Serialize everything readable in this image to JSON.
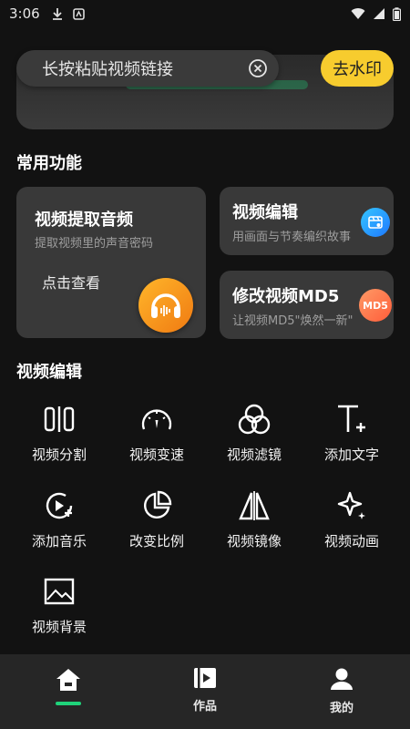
{
  "status_bar": {
    "time": "3:06"
  },
  "search": {
    "placeholder": "长按粘贴视频链接",
    "action_label": "去水印"
  },
  "sections": {
    "common_title": "常用功能",
    "tools_title": "视频编辑"
  },
  "cards": {
    "extract_audio": {
      "title": "视频提取音频",
      "subtitle": "提取视频里的声音密码",
      "action": "点击查看"
    },
    "video_edit": {
      "title": "视频编辑",
      "subtitle": "用画面与节奏编织故事"
    },
    "modify_md5": {
      "title": "修改视频MD5",
      "subtitle": "让视频MD5\"焕然一新\"",
      "badge": "MD5"
    }
  },
  "tools": [
    {
      "label": "视频分割",
      "icon": "split-icon"
    },
    {
      "label": "视频变速",
      "icon": "speedometer-icon"
    },
    {
      "label": "视频滤镜",
      "icon": "filter-icon"
    },
    {
      "label": "添加文字",
      "icon": "add-text-icon"
    },
    {
      "label": "添加音乐",
      "icon": "add-music-icon"
    },
    {
      "label": "改变比例",
      "icon": "ratio-pie-icon"
    },
    {
      "label": "视频镜像",
      "icon": "mirror-icon"
    },
    {
      "label": "视频动画",
      "icon": "sparkle-icon"
    },
    {
      "label": "视频背景",
      "icon": "background-image-icon"
    }
  ],
  "nav": [
    {
      "label": "",
      "icon": "home-icon",
      "active": true
    },
    {
      "label": "作品",
      "icon": "works-icon"
    },
    {
      "label": "我的",
      "icon": "profile-icon"
    }
  ],
  "colors": {
    "accent": "#1fd37a",
    "button": "#f7cc2e",
    "card": "#393939",
    "background": "#121212"
  }
}
